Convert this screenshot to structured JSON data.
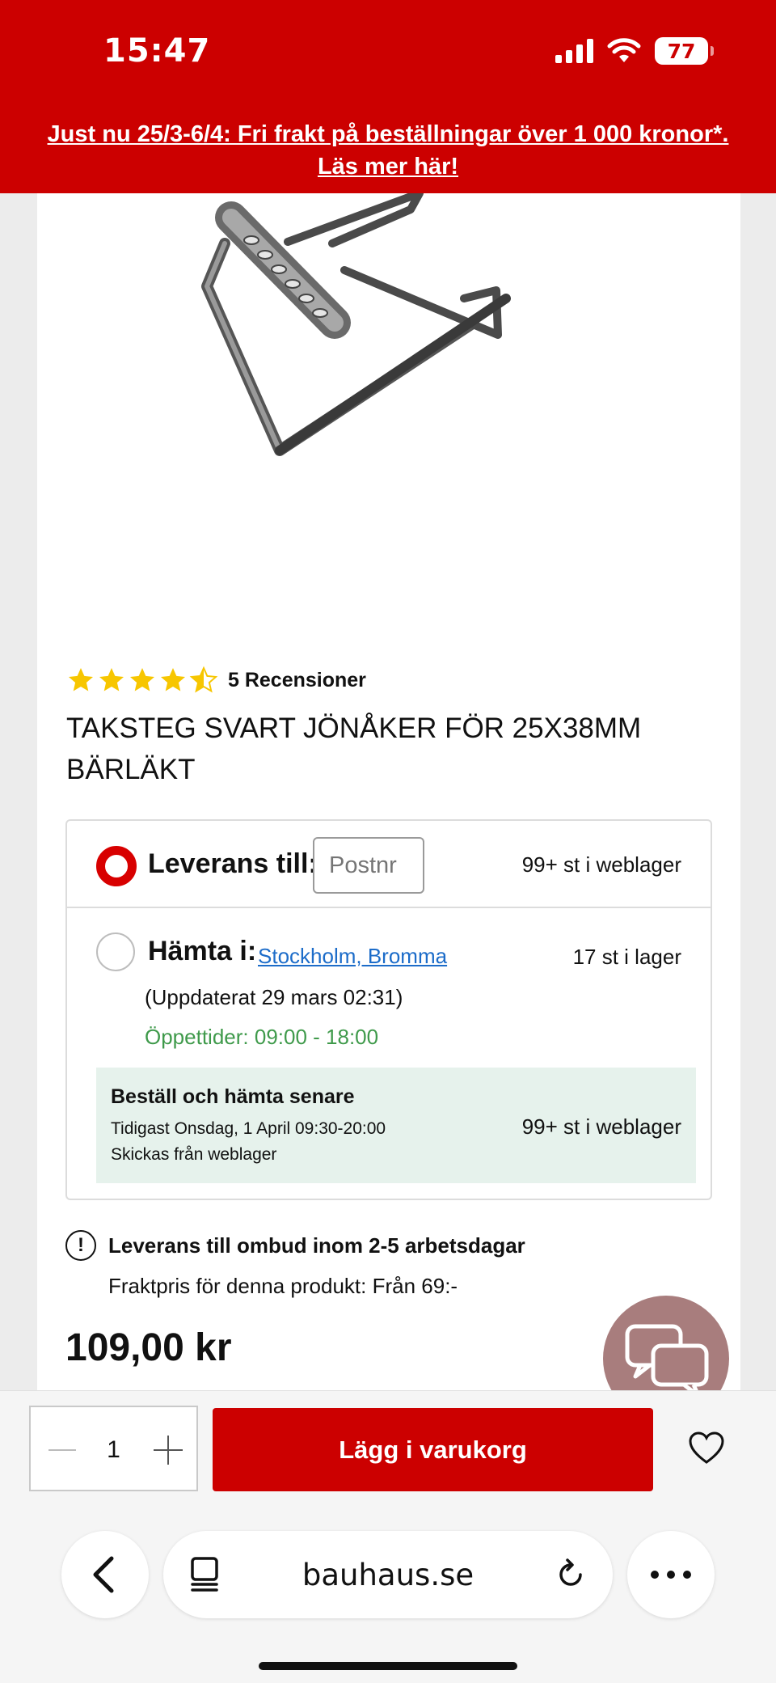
{
  "status_bar": {
    "time": "15:47",
    "battery": "77"
  },
  "promo_banner": {
    "text_line1": "Just nu 25/3-6/4: Fri frakt på beställningar över 1 000 kronor*.",
    "text_line2": "Läs mer här!"
  },
  "product": {
    "rating_stars": 4.5,
    "reviews_label": "5 Recensioner",
    "title": "TAKSTEG SVART JÖNÅKER FÖR 25X38MM BÄRLÄKT",
    "price": "109,00 kr"
  },
  "availability": {
    "delivery": {
      "label": "Leverans till:",
      "postal_placeholder": "Postnr",
      "stock": "99+ st i weblager",
      "selected": true
    },
    "pickup": {
      "label": "Hämta i:",
      "store": "Stockholm, Bromma",
      "stock": "17 st i lager",
      "updated": "(Uppdaterat 29 mars 02:31)",
      "opening_hours": "Öppettider: 09:00 - 18:00",
      "selected": false
    },
    "collect_later": {
      "title": "Beställ och hämta senare",
      "earliest": "Tidigast Onsdag, 1 April 09:30-20:00",
      "shipped_from": "Skickas från weblager",
      "stock": "99+ st i weblager"
    }
  },
  "shipping_info": {
    "title": "Leverans till ombud inom 2-5 arbetsdagar",
    "price_text": "Fraktpris för denna produkt: Från 69:-"
  },
  "purchase": {
    "quantity": "1",
    "add_to_cart_label": "Lägg i varukorg"
  },
  "browser": {
    "url": "bauhaus.se"
  },
  "colors": {
    "brand_red": "#cc0000",
    "link_blue": "#1c6cc9",
    "hours_green": "#3f9a4b",
    "collect_bg": "#e6f2ec",
    "star_yellow": "#f7c600",
    "chat_bubble": "#a87d7d"
  },
  "icons": [
    "signal-icon",
    "wifi-icon",
    "battery-icon",
    "star-icon",
    "info-icon",
    "chat-icon",
    "heart-icon",
    "back-icon",
    "reader-icon",
    "reload-icon",
    "more-icon"
  ]
}
